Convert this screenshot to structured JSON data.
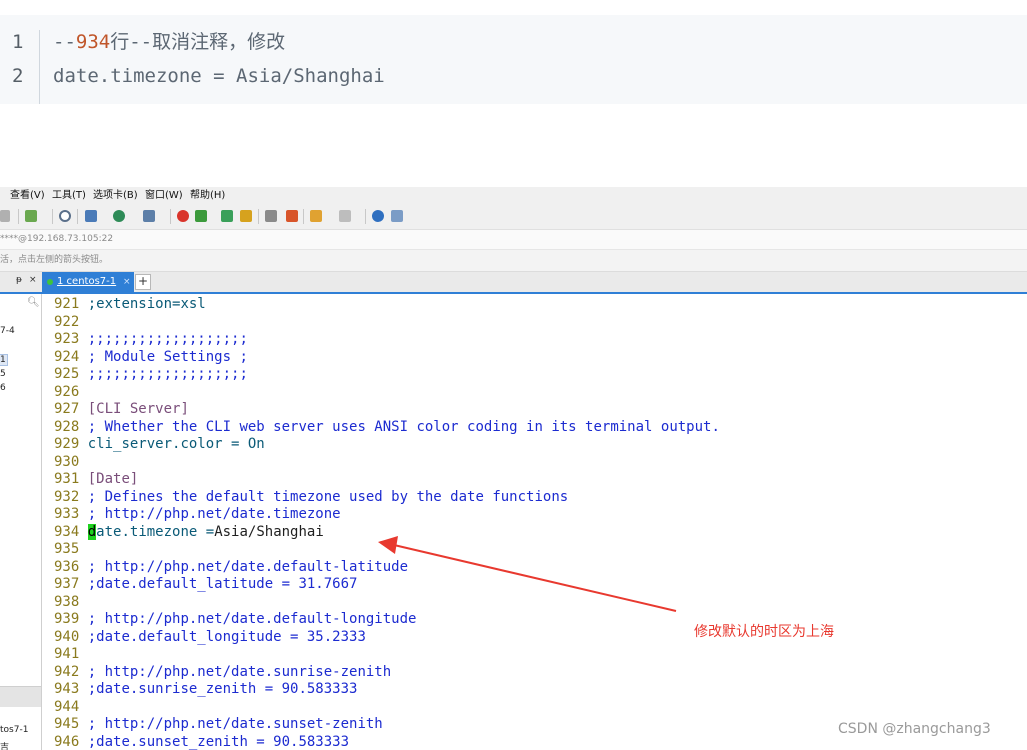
{
  "snippet": {
    "lines": [
      {
        "number": "1",
        "prefix": "--",
        "highlight": "934",
        "suffix": "行--取消注释，修改"
      },
      {
        "number": "2",
        "text": "date.timezone = Asia/Shanghai"
      }
    ]
  },
  "menubar": {
    "items": [
      "查看(V)",
      "工具(T)",
      "选项卡(B)",
      "窗口(W)",
      "帮助(H)"
    ]
  },
  "toolbar": {
    "icons": [
      "link-icon",
      "new-session-icon",
      "search-icon",
      "layout-icon",
      "globe-icon",
      "font-icon",
      "record-icon",
      "transfer-icon",
      "fullscreen-icon",
      "lock-icon",
      "keyboard-icon",
      "pen-icon",
      "folder-icon",
      "window-icon",
      "help-icon",
      "chat-icon"
    ]
  },
  "addressbar": {
    "text": "****@192.168.73.105:22"
  },
  "hintbar": {
    "text": "活，点击左侧的箭头按钮。"
  },
  "tabs": {
    "pin_label": "ᵽ",
    "close_label": "×",
    "active_label": "1 centos7-1",
    "active_close": "×",
    "add_label": "+"
  },
  "sidebar": {
    "items": [
      "7-4",
      "1",
      "5",
      "6"
    ],
    "bottom_items": [
      "tos7-1",
      "吉"
    ]
  },
  "terminal": {
    "lines": [
      {
        "n": "921",
        "t": ";extension=xsl",
        "k": "setting"
      },
      {
        "n": "922",
        "t": "",
        "k": "plain"
      },
      {
        "n": "923",
        "t": ";;;;;;;;;;;;;;;;;;;",
        "k": "comment"
      },
      {
        "n": "924",
        "t": "; Module Settings ;",
        "k": "comment"
      },
      {
        "n": "925",
        "t": ";;;;;;;;;;;;;;;;;;;",
        "k": "comment"
      },
      {
        "n": "926",
        "t": "",
        "k": "plain"
      },
      {
        "n": "927",
        "t": "[CLI Server]",
        "k": "section"
      },
      {
        "n": "928",
        "t": "; Whether the CLI web server uses ANSI color coding in its terminal output.",
        "k": "comment"
      },
      {
        "n": "929",
        "t": "cli_server.color = On",
        "k": "setting"
      },
      {
        "n": "930",
        "t": "",
        "k": "plain"
      },
      {
        "n": "931",
        "t": "[Date]",
        "k": "section"
      },
      {
        "n": "932",
        "t": "; Defines the default timezone used by the date functions",
        "k": "comment"
      },
      {
        "n": "933",
        "t": "; http://php.net/date.timezone",
        "k": "comment"
      },
      {
        "n": "934",
        "t": "date.timezone =Asia/Shanghai",
        "k": "cursorline"
      },
      {
        "n": "935",
        "t": "",
        "k": "plain"
      },
      {
        "n": "936",
        "t": "; http://php.net/date.default-latitude",
        "k": "comment"
      },
      {
        "n": "937",
        "t": ";date.default_latitude = 31.7667",
        "k": "comment"
      },
      {
        "n": "938",
        "t": "",
        "k": "plain"
      },
      {
        "n": "939",
        "t": "; http://php.net/date.default-longitude",
        "k": "comment"
      },
      {
        "n": "940",
        "t": ";date.default_longitude = 35.2333",
        "k": "comment"
      },
      {
        "n": "941",
        "t": "",
        "k": "plain"
      },
      {
        "n": "942",
        "t": "; http://php.net/date.sunrise-zenith",
        "k": "comment"
      },
      {
        "n": "943",
        "t": ";date.sunrise_zenith = 90.583333",
        "k": "comment"
      },
      {
        "n": "944",
        "t": "",
        "k": "plain"
      },
      {
        "n": "945",
        "t": "; http://php.net/date.sunset-zenith",
        "k": "comment"
      },
      {
        "n": "946",
        "t": ";date.sunset_zenith = 90.583333",
        "k": "comment"
      }
    ]
  },
  "annotation": {
    "text": "修改默认的时区为上海",
    "color": "#e8392f"
  },
  "watermark": {
    "text": "CSDN @zhangchang3"
  },
  "colors": {
    "tab_active": "#2f7fd6",
    "cursor": "#1fd21f",
    "line_number": "#8a7a1e",
    "comment": "#1c2bd0"
  }
}
